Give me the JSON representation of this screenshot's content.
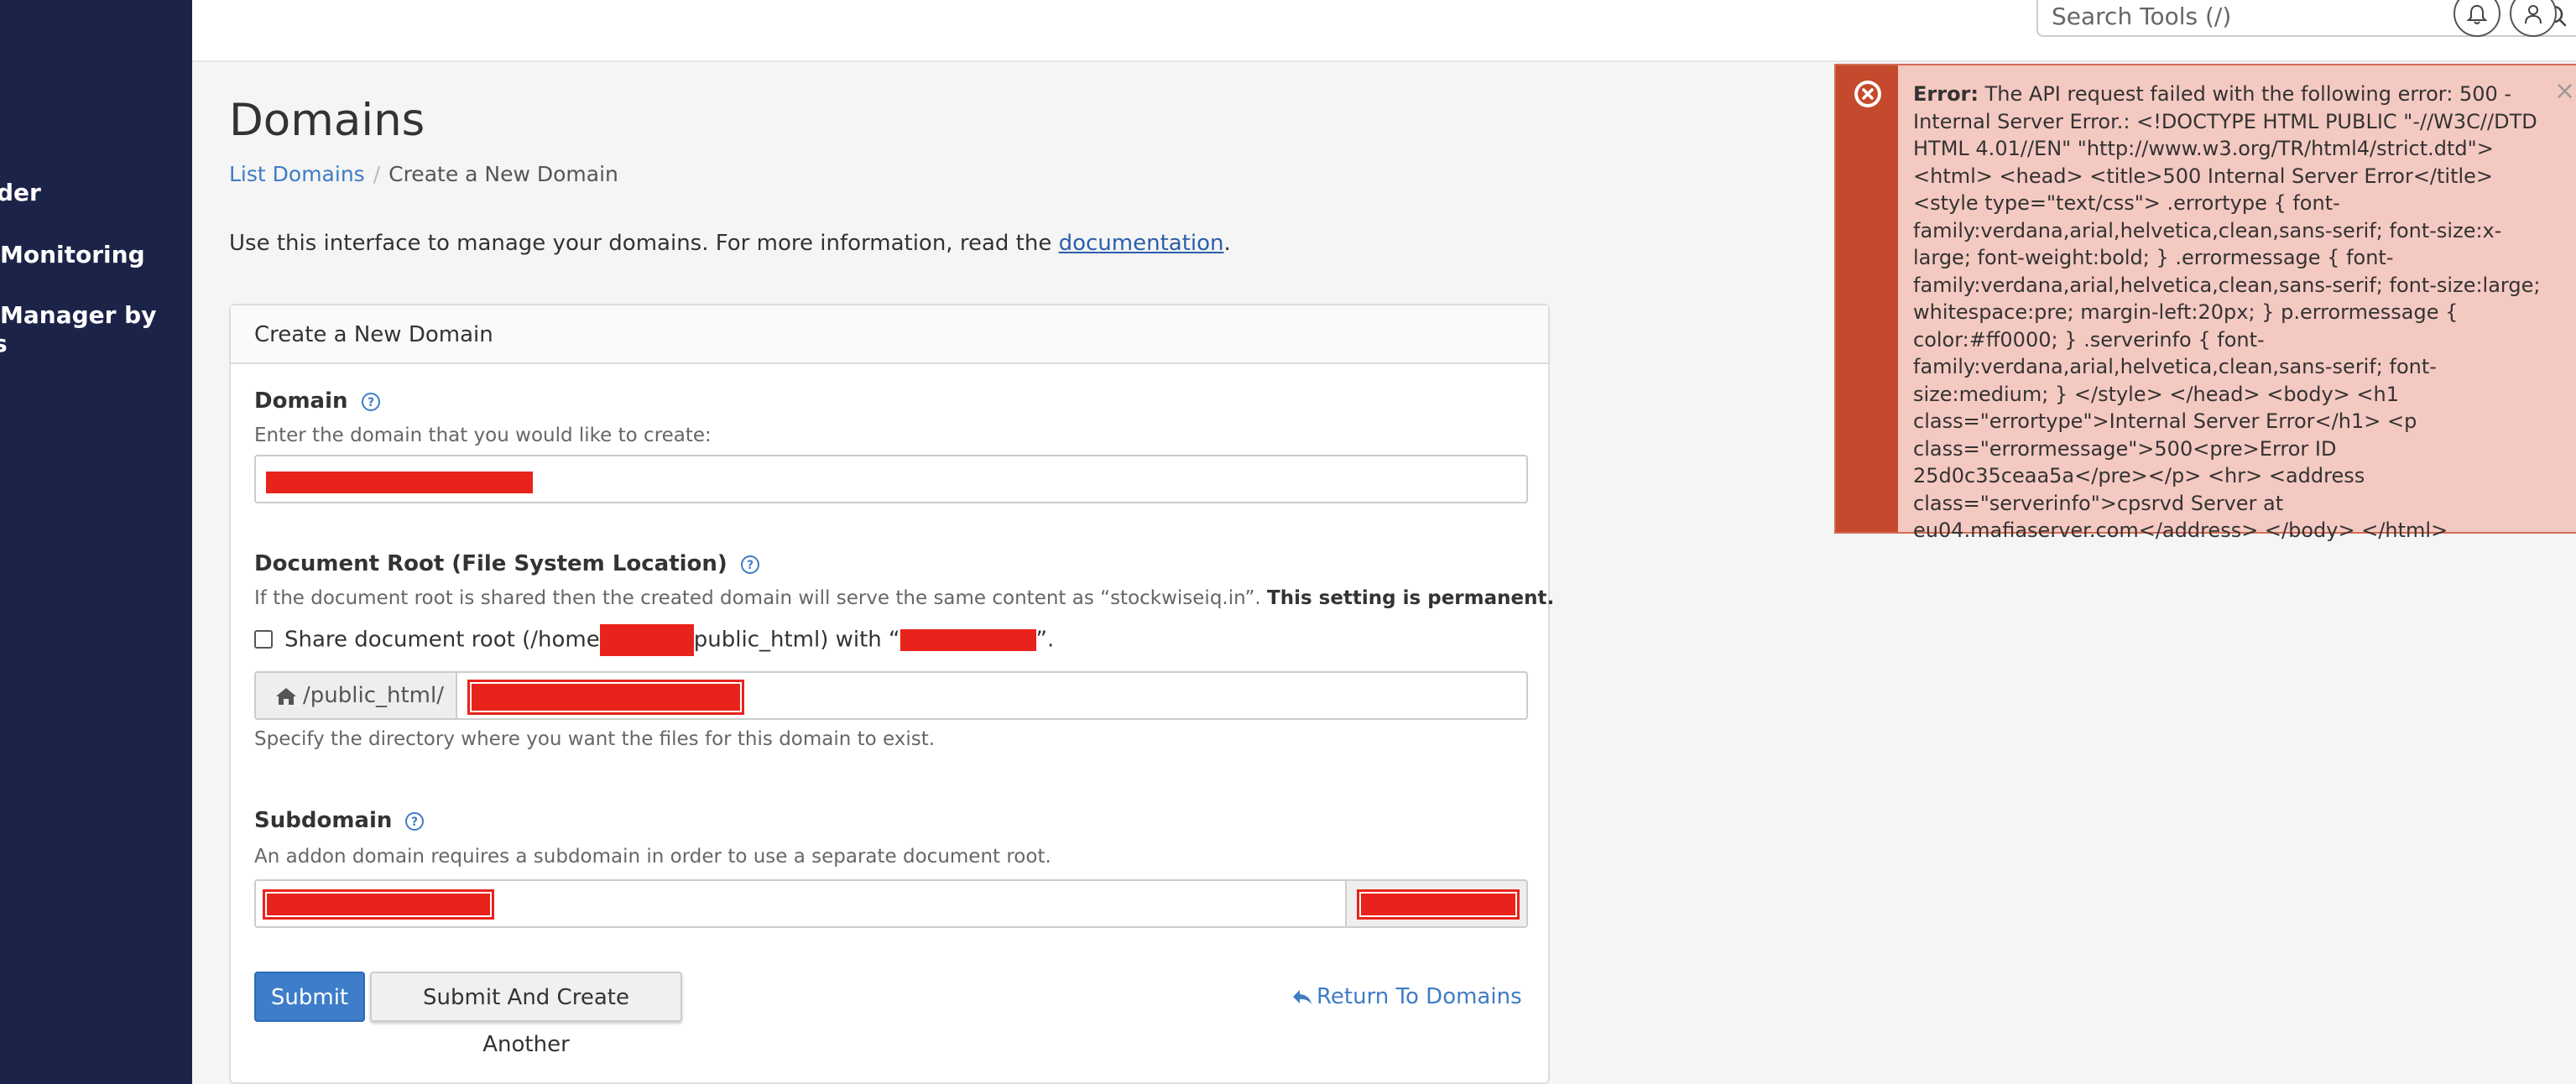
{
  "sidebar": {
    "items": [
      {
        "label": "der"
      },
      {
        "label": "Monitoring"
      },
      {
        "label": "Manager by"
      },
      {
        "label": "s"
      }
    ]
  },
  "header": {
    "search_placeholder": "Search Tools (/)"
  },
  "page": {
    "title": "Domains",
    "breadcrumb": [
      "List Domains",
      "Create a New Domain"
    ],
    "intro_text": "Use this interface to manage your domains. For more information, read the ",
    "intro_link": "documentation",
    "intro_end": "."
  },
  "form": {
    "panel_title": "Create a New Domain",
    "domain": {
      "label": "Domain",
      "help": "Enter the domain that you would like to create:"
    },
    "docroot": {
      "label": "Document Root (File System Location)",
      "help": "If the document root is shared then the created domain will serve the same content as “stockwiseiq.in”.",
      "help_bold": "This setting is permanent.",
      "share_prefix": "Share document root (/home",
      "share_mid": "public_html) with “",
      "share_end": "”.",
      "prefix": "/public_html/",
      "after_help": "Specify the directory where you want the files for this domain to exist."
    },
    "subdomain": {
      "label": "Subdomain",
      "help": "An addon domain requires a subdomain in order to use a separate document root."
    },
    "buttons": {
      "submit": "Submit",
      "submit_another": "Submit And Create Another",
      "return": "Return To Domains"
    }
  },
  "alert": {
    "title": "Error:",
    "message": "The API request failed with the following error: 500 - Internal Server Error.: <!DOCTYPE HTML PUBLIC \"-//W3C//DTD HTML 4.01//EN\" \"http://www.w3.org/TR/html4/strict.dtd\"> <html> <head> <title>500 Internal Server Error</title> <style type=\"text/css\"> .errortype { font-family:verdana,arial,helvetica,clean,sans-serif; font-size:x-large; font-weight:bold; } .errormessage { font-family:verdana,arial,helvetica,clean,sans-serif; font-size:large; whitespace:pre; margin-left:20px; } p.errormessage { color:#ff0000; } .serverinfo { font-family:verdana,arial,helvetica,clean,sans-serif; font-size:medium; } </style> </head> <body> <h1 class=\"errortype\">Internal Server Error</h1> <p class=\"errormessage\">500<pre>Error ID 25d0c35ceaa5a</pre></p> <hr> <address class=\"serverinfo\">cpsrvd Server at eu04.mafiaserver.com</address> </body> </html>",
    "close": "×"
  },
  "colors": {
    "sidebar": "#1c2348",
    "primary": "#3d7dca",
    "link": "#3f7cc5",
    "alert_bg": "#f4c9c1",
    "alert_stripe": "#c5492c",
    "redaction": "#e8231b"
  }
}
